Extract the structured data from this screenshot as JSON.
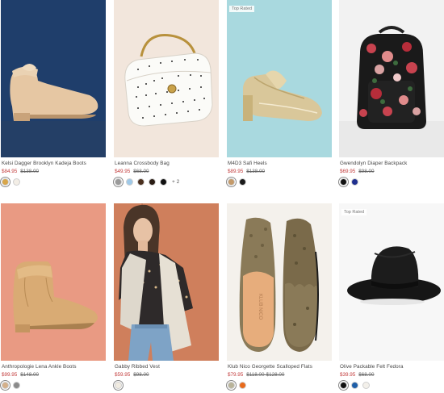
{
  "products": [
    {
      "name": "Kelsi Dagger Brooklyn Kadeja Boots",
      "sale_price": "$84.95",
      "original_price": "$138.00",
      "badge": "",
      "swatches": [
        "#d8a64a",
        "#f3eee6"
      ]
    },
    {
      "name": "Leanna Crossbody Bag",
      "sale_price": "$49.95",
      "original_price": "$68.00",
      "badge": "",
      "swatches": [
        "#9a9a9a",
        "#9fc9e8",
        "#4a2f1e",
        "#2a1c14",
        "#111111"
      ],
      "more_colors": "+ 2"
    },
    {
      "name": "M4D3 Safi Heels",
      "sale_price": "$89.95",
      "original_price": "$138.00",
      "badge": "Top Rated",
      "swatches": [
        "#c49a6a",
        "#1a1a1a"
      ]
    },
    {
      "name": "Gwendolyn Diaper Backpack",
      "sale_price": "$69.95",
      "original_price": "$98.00",
      "badge": "",
      "swatches": [
        "#111111",
        "#1f2f8f"
      ]
    },
    {
      "name": "Anthropologie Lena Ankle Boots",
      "sale_price": "$99.95",
      "original_price": "$148.00",
      "badge": "",
      "swatches": [
        "#d4b08a",
        "#8a8a8a"
      ]
    },
    {
      "name": "Gabby Ribbed Vest",
      "sale_price": "$59.95",
      "original_price": "$98.00",
      "badge": "",
      "swatches": [
        "#f1ece2"
      ]
    },
    {
      "name": "Klub Nico Georgette Scalloped Flats",
      "sale_price": "$79.95",
      "original_price": "$118.00-$128.00",
      "badge": "",
      "swatches": [
        "#b9b49a",
        "#e86a1c"
      ]
    },
    {
      "name": "Olive Packable Felt Fedora",
      "sale_price": "$39.95",
      "original_price": "$68.00",
      "badge": "Top Rated",
      "swatches": [
        "#111111",
        "#1f5fa8",
        "#f3f0ea"
      ]
    }
  ]
}
